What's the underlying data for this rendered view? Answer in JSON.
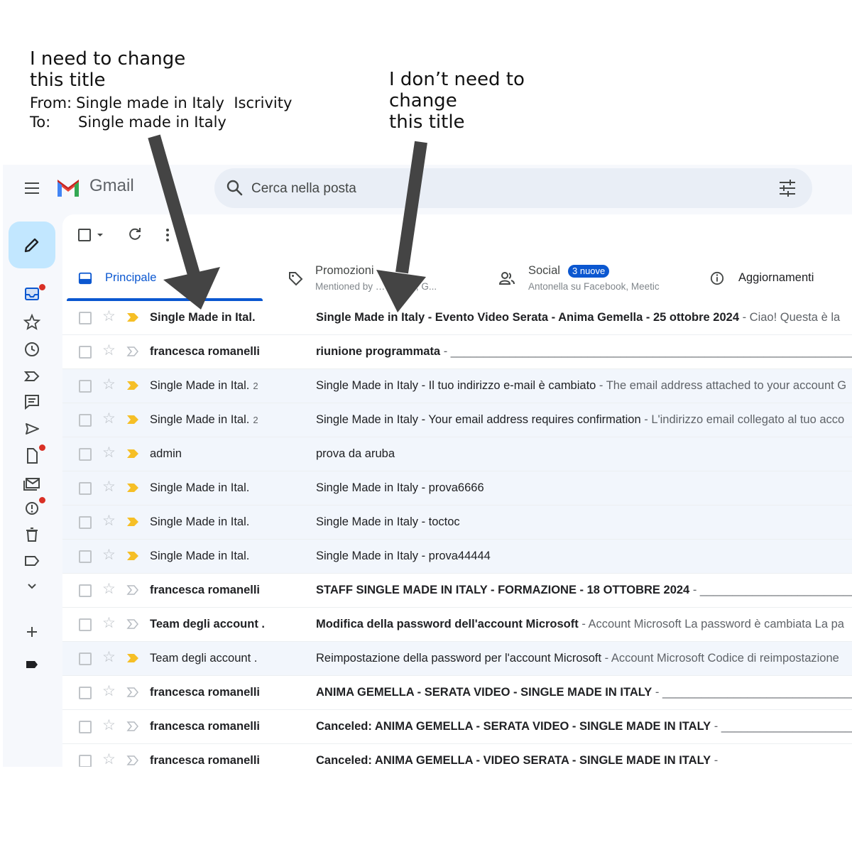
{
  "annotations": {
    "left": {
      "title_line1": "I need to change",
      "title_line2": "this title",
      "from_label": "From:",
      "from_value": "Single made in Italy  Iscrivity",
      "to_label": "To:",
      "to_value": "Single made in Italy"
    },
    "right": {
      "line1": "I don’t need to",
      "line2": "change",
      "line3": "this title"
    }
  },
  "header": {
    "app_name": "Gmail",
    "search_placeholder": "Cerca nella posta"
  },
  "tabs": [
    {
      "label": "Principale",
      "active": true
    },
    {
      "label": "Promozioni",
      "subtitle": "Mentioned by …essem., G..."
    },
    {
      "label": "Social",
      "badge": "3 nuove",
      "subtitle": "Antonella su Facebook, Meetic"
    },
    {
      "label": "Aggiornamenti"
    }
  ],
  "emails": [
    {
      "sender": "Single Made in Ital.",
      "count": "",
      "subject": "Single Made in Italy - Evento Video Serata - Anima Gemella - 25 ottobre 2024",
      "snippet": " - Ciao! Questa è la",
      "unread": true,
      "important": true
    },
    {
      "sender": "francesca romanelli",
      "count": "",
      "subject": "riunione programmata",
      "snippet": " - ______________________________________________________________",
      "unread": true,
      "important": false
    },
    {
      "sender": "Single Made in Ital.",
      "count": "2",
      "subject": "Single Made in Italy - Il tuo indirizzo e-mail è cambiato",
      "snippet": " - The email address attached to your account G",
      "unread": false,
      "important": true
    },
    {
      "sender": "Single Made in Ital.",
      "count": "2",
      "subject": "Single Made in Italy - Your email address requires confirmation",
      "snippet": " - L'indirizzo email collegato al tuo acco",
      "unread": false,
      "important": true
    },
    {
      "sender": "admin",
      "count": "",
      "subject": "prova da aruba",
      "snippet": "",
      "unread": false,
      "important": true
    },
    {
      "sender": "Single Made in Ital.",
      "count": "",
      "subject": "Single Made in Italy - prova6666",
      "snippet": "",
      "unread": false,
      "important": true
    },
    {
      "sender": "Single Made in Ital.",
      "count": "",
      "subject": "Single Made in Italy - toctoc",
      "snippet": "",
      "unread": false,
      "important": true
    },
    {
      "sender": "Single Made in Ital.",
      "count": "",
      "subject": "Single Made in Italy - prova44444",
      "snippet": "",
      "unread": false,
      "important": true
    },
    {
      "sender": "francesca romanelli",
      "count": "",
      "subject": "STAFF SINGLE MADE IN ITALY - FORMAZIONE - 18 OTTOBRE 2024",
      "snippet": " - ______________________________",
      "unread": true,
      "important": false
    },
    {
      "sender": "Team degli account .",
      "count": "",
      "subject": "Modifica della password dell'account Microsoft",
      "snippet": " - Account Microsoft La password è cambiata La pa",
      "unread": true,
      "important": false
    },
    {
      "sender": "Team degli account .",
      "count": "",
      "subject": "Reimpostazione della password per l'account Microsoft",
      "snippet": " - Account Microsoft Codice di reimpostazione",
      "unread": false,
      "important": true
    },
    {
      "sender": "francesca romanelli",
      "count": "",
      "subject": "ANIMA GEMELLA - SERATA VIDEO - SINGLE MADE IN ITALY",
      "snippet": " - ______________________________",
      "unread": true,
      "important": false
    },
    {
      "sender": "francesca romanelli",
      "count": "",
      "subject": "Canceled: ANIMA GEMELLA - SERATA VIDEO - SINGLE MADE IN ITALY",
      "snippet": " - ______________________________",
      "unread": true,
      "important": false
    },
    {
      "sender": "francesca romanelli",
      "count": "",
      "subject": "Canceled: ANIMA GEMELLA - VIDEO SERATA - SINGLE MADE IN ITALY",
      "snippet": " -",
      "unread": true,
      "important": false
    }
  ],
  "colors": {
    "accent": "#0b57d0",
    "important_marker": "#f6bf26",
    "notification_dot": "#d93025",
    "compose_bg": "#c2e7ff",
    "arrow": "#444444"
  }
}
